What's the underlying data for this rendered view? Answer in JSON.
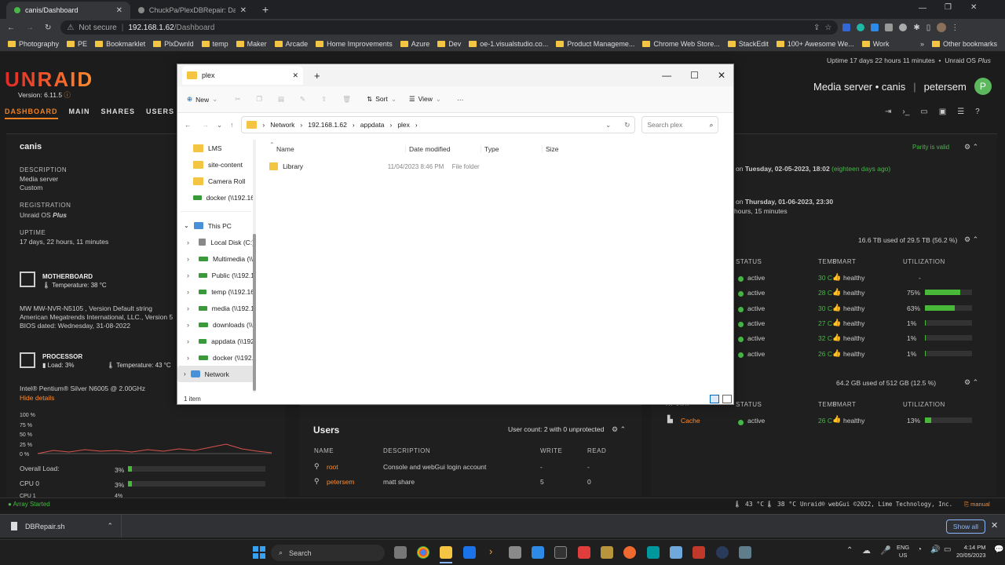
{
  "browser": {
    "tabs": [
      {
        "title": "canis/Dashboard",
        "active": true
      },
      {
        "title": "ChuckPa/PlexDBRepair: Databas",
        "active": false
      }
    ],
    "security": "Not secure",
    "url_host": "192.168.1.62",
    "url_path": "/Dashboard",
    "bookmarks": [
      "Photography",
      "PE",
      "Bookmarklet",
      "PlxDwnld",
      "temp",
      "Maker",
      "Arcade",
      "Home Improvements",
      "Azure",
      "Dev",
      "oe-1.visualstudio.co...",
      "Product Manageme...",
      "Chrome Web Store...",
      "StackEdit",
      "100+ Awesome We...",
      "Work"
    ],
    "other_bookmarks": "Other bookmarks"
  },
  "unraid": {
    "logo": "UNRAID",
    "version": "Version: 6.11.5",
    "uptime_banner": "Uptime 17 days 22 hours 11 minutes",
    "os_banner": "Unraid OS",
    "os_banner_plus": "Plus",
    "server_title": "Media server • canis",
    "user": "petersem",
    "avatar_letter": "P",
    "nav": [
      "DASHBOARD",
      "MAIN",
      "SHARES",
      "USERS",
      "SE"
    ],
    "server": {
      "name": "canis",
      "desc_label": "DESCRIPTION",
      "desc1": "Media server",
      "desc2": "Custom",
      "reg_label": "REGISTRATION",
      "reg_value": "Unraid OS",
      "reg_plus": "Plus",
      "uptime_label": "UPTIME",
      "uptime_value": "17 days, 22 hours, 11 minutes"
    },
    "motherboard": {
      "title": "MOTHERBOARD",
      "temp": "Temperature: 38 °C",
      "line1": "MW MW-NVR-N5105 , Version Default string",
      "line2": "American Megatrends International, LLC., Version 5",
      "line3": "BIOS dated: Wednesday, 31-08-2022"
    },
    "processor": {
      "title": "PROCESSOR",
      "load": "Load: 3%",
      "temp": "Temperature: 43 °C",
      "model": "Intel® Pentium® Silver N6005 @ 2.00GHz",
      "hide": "Hide details",
      "ylabels": [
        "100 %",
        "75 %",
        "50 %",
        "25 %",
        "0 %"
      ],
      "overall_label": "Overall Load:",
      "overall_val": "3%",
      "overall_fraction": 0.03,
      "cpu0_label": "CPU 0",
      "cpu0_val": "3%",
      "cpu0_fraction": 0.03,
      "cpu1_label": "CPU 1",
      "cpu1_val": "4%"
    },
    "parity": {
      "valid": "Parity is valid",
      "last_prefix": "on",
      "last_date": "Tuesday, 02-05-2023, 18:02",
      "last_ago": "(eighteen days ago)",
      "next_prefix": "on",
      "next_date": "Thursday, 01-06-2023, 23:30",
      "next_dur": "hours, 15 minutes"
    },
    "array": {
      "usage": "16.6 TB used of 29.5 TB (56.2 %)",
      "headers": [
        "STATUS",
        "TEMP",
        "SMART",
        "UTILIZATION"
      ],
      "rows": [
        {
          "status": "active",
          "temp": "30 C",
          "smart": "healthy",
          "util": "-",
          "fraction": 0
        },
        {
          "status": "active",
          "temp": "28 C",
          "smart": "healthy",
          "util": "75%",
          "fraction": 0.75
        },
        {
          "status": "active",
          "temp": "30 C",
          "smart": "healthy",
          "util": "63%",
          "fraction": 0.63
        },
        {
          "status": "active",
          "temp": "27 C",
          "smart": "healthy",
          "util": "1%",
          "fraction": 0.01
        },
        {
          "status": "active",
          "temp": "32 C",
          "smart": "healthy",
          "util": "1%",
          "fraction": 0.01
        },
        {
          "status": "active",
          "temp": "26 C",
          "smart": "healthy",
          "util": "1%",
          "fraction": 0.01
        }
      ]
    },
    "cache": {
      "usage": "64.2 GB used of 512 GB (12.5 %)",
      "headers": [
        "DEVICE",
        "STATUS",
        "TEMP",
        "SMART",
        "UTILIZATION"
      ],
      "name": "Cache",
      "status": "active",
      "temp": "26 C",
      "smart": "healthy",
      "util": "13%",
      "fraction": 0.13
    },
    "users": {
      "title": "Users",
      "count": "User count: 2 with 0 unprotected",
      "headers": [
        "NAME",
        "DESCRIPTION",
        "WRITE",
        "READ"
      ],
      "rows": [
        {
          "name": "root",
          "desc": "Console and webGui login account",
          "write": "-",
          "read": "-"
        },
        {
          "name": "petersem",
          "desc": "matt share",
          "write": "5",
          "read": "0"
        }
      ]
    },
    "footer": {
      "status": "Array Started",
      "temp1": "43 °C",
      "temp2": "38 °C",
      "copyright": "Unraid® webGui ©2022, Lime Technology, Inc.",
      "manual": "manual"
    }
  },
  "explorer": {
    "tab_title": "plex",
    "new": "New",
    "sort": "Sort",
    "view": "View",
    "breadcrumb": [
      "Network",
      "192.168.1.62",
      "appdata",
      "plex"
    ],
    "search_placeholder": "Search plex",
    "sidebar": [
      {
        "label": "LMS",
        "type": "folder"
      },
      {
        "label": "site-content",
        "type": "folder"
      },
      {
        "label": "Camera Roll",
        "type": "folder"
      },
      {
        "label": "docker (\\\\192.16",
        "type": "drive"
      }
    ],
    "this_pc": "This PC",
    "drives": [
      "Local Disk (C:)",
      "Multimedia (\\\\",
      "Public (\\\\192.1",
      "temp (\\\\192.16",
      "media (\\\\192.1",
      "downloads (\\\\",
      "appdata (\\\\192",
      "docker (\\\\192."
    ],
    "network": "Network",
    "columns": [
      "Name",
      "Date modified",
      "Type",
      "Size"
    ],
    "files": [
      {
        "name": "Library",
        "date": "11/04/2023 8:46 PM",
        "type": "File folder",
        "size": ""
      }
    ],
    "status": "1 item"
  },
  "download": {
    "file": "DBRepair.sh",
    "show_all": "Show all"
  },
  "taskbar": {
    "search": "Search",
    "lang1": "ENG",
    "lang2": "US",
    "time": "4:14 PM",
    "date": "20/05/2023"
  }
}
